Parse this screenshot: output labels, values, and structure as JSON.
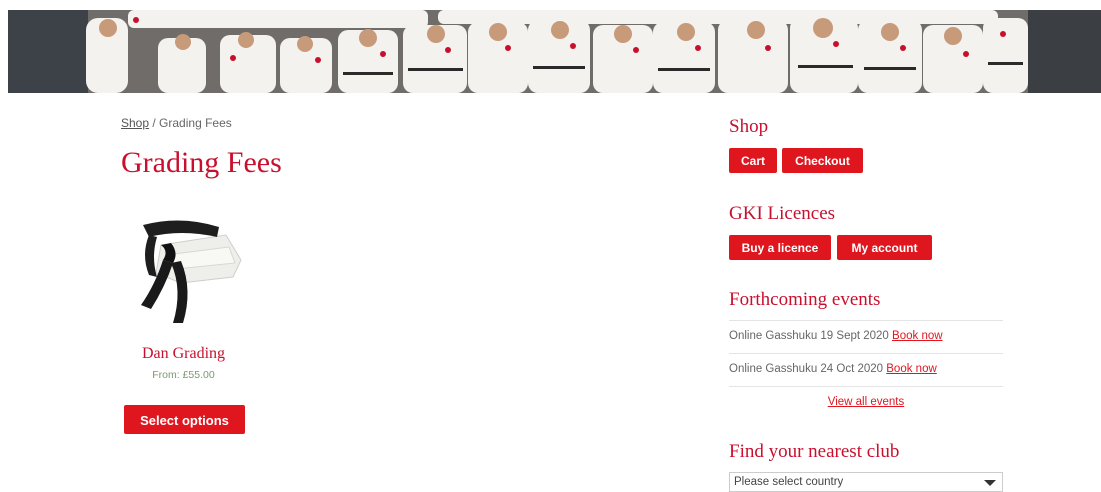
{
  "breadcrumb": {
    "shop": "Shop",
    "separator": " / ",
    "current": "Grading Fees"
  },
  "page_title": "Grading Fees",
  "product": {
    "name": "Dan Grading",
    "price": "From: £55.00",
    "button": "Select options"
  },
  "sidebar": {
    "shop": {
      "title": "Shop",
      "cart": "Cart",
      "checkout": "Checkout"
    },
    "licences": {
      "title": "GKI Licences",
      "buy": "Buy a licence",
      "account": "My account"
    },
    "events": {
      "title": "Forthcoming events",
      "items": [
        {
          "text": "Online Gasshuku 19 Sept 2020 ",
          "link": "Book now"
        },
        {
          "text": "Online Gasshuku 24 Oct 2020 ",
          "link": "Book now"
        }
      ],
      "view_all": "View all events"
    },
    "club": {
      "title": "Find your nearest club",
      "select_value": "Please select country"
    }
  },
  "colors": {
    "accent": "#e0161f",
    "heading": "#c8102e",
    "price": "#7a9a6a"
  }
}
